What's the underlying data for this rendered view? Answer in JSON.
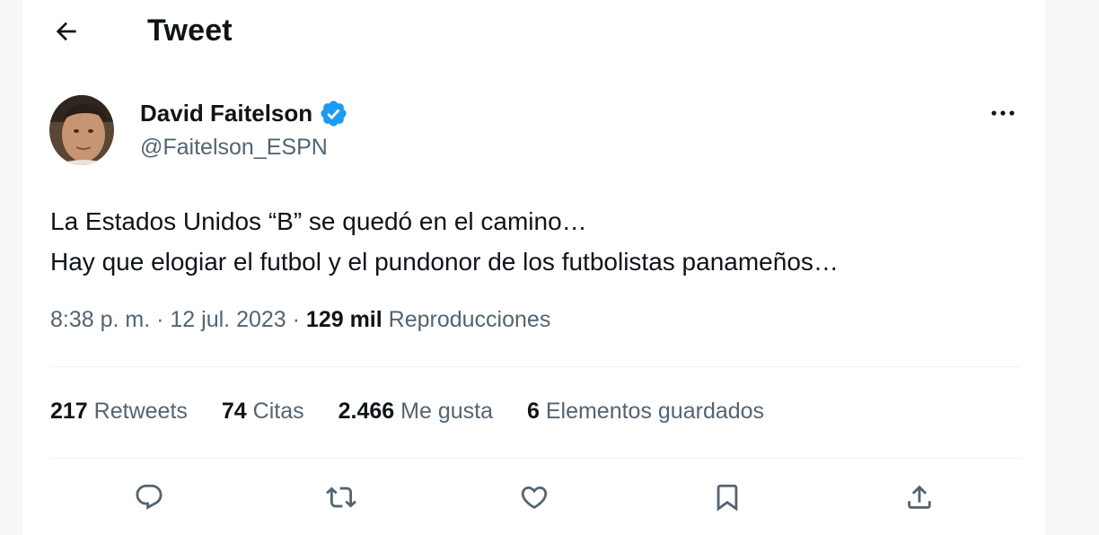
{
  "header": {
    "title": "Tweet",
    "back_icon": "arrow-left-icon"
  },
  "author": {
    "display_name": "David Faitelson",
    "handle": "@Faitelson_ESPN",
    "verified_color": "#1d9bf0"
  },
  "tweet": {
    "text": "La Estados Unidos “B” se quedó en el camino…\nHay que elogiar el futbol y el pundonor de los futbolistas panameños…",
    "time": "8:38 p. m.",
    "separator": "·",
    "date": "12 jul. 2023",
    "views_count": "129 mil",
    "views_label": "Reproducciones"
  },
  "stats": [
    {
      "count": "217",
      "label": "Retweets"
    },
    {
      "count": "74",
      "label": "Citas"
    },
    {
      "count": "2.466",
      "label": "Me gusta"
    },
    {
      "count": "6",
      "label": "Elementos guardados"
    }
  ],
  "actions": [
    {
      "icon": "reply-icon"
    },
    {
      "icon": "retweet-icon"
    },
    {
      "icon": "like-heart-icon"
    },
    {
      "icon": "bookmark-icon"
    },
    {
      "icon": "share-icon"
    }
  ],
  "colors": {
    "text_primary": "#0f1419",
    "text_secondary": "#536471",
    "accent": "#1d9bf0",
    "divider": "#eff3f4"
  }
}
